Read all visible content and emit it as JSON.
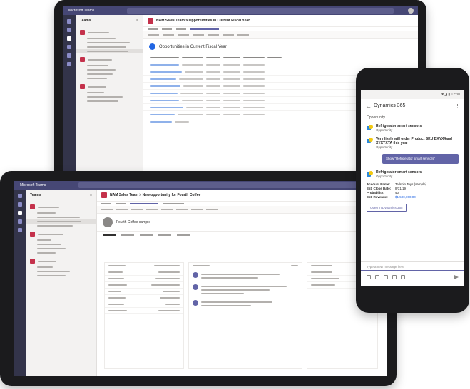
{
  "laptop": {
    "app_name": "Microsoft Teams",
    "panel_title": "Teams",
    "channel_title": "NAM Sales Team > Opportunities in Current Fiscal Year",
    "view_title": "Opportunities in Current Fiscal Year"
  },
  "tablet": {
    "app_name": "Microsoft Teams",
    "panel_title": "Teams",
    "channel_title": "NAM Sales Team > New opportunity for Fourth Coffee",
    "record_name": "Fourth Coffee sample"
  },
  "phone": {
    "status_time": "▼◢ ▮ 12:30",
    "title": "Dynamics 365",
    "first_label": "Opportunity",
    "cards": [
      {
        "title": "Refrigerator smart sensors",
        "subtitle": "Opportunity"
      },
      {
        "title": "Very likely will order Product SKU BXYX4and XYXYXYA this year",
        "subtitle": "Opportunity"
      }
    ],
    "message": "Show \"Refrigerator smart sensors\"",
    "result_card": {
      "title": "Refrigerator smart sensors",
      "subtitle": "Opportunity"
    },
    "details": [
      {
        "key": "Account Name:",
        "value": "Tailspin Toys (sample)",
        "link": false
      },
      {
        "key": "Est. Close Date:",
        "value": "8/31/19",
        "link": false
      },
      {
        "key": "Probability:",
        "value": "40",
        "link": false
      },
      {
        "key": "Est. Revenue:",
        "value": "$1,500,000.00",
        "link": true
      }
    ],
    "open_button": "Open in Dynamics 365",
    "compose_placeholder": "Type a new message here"
  }
}
